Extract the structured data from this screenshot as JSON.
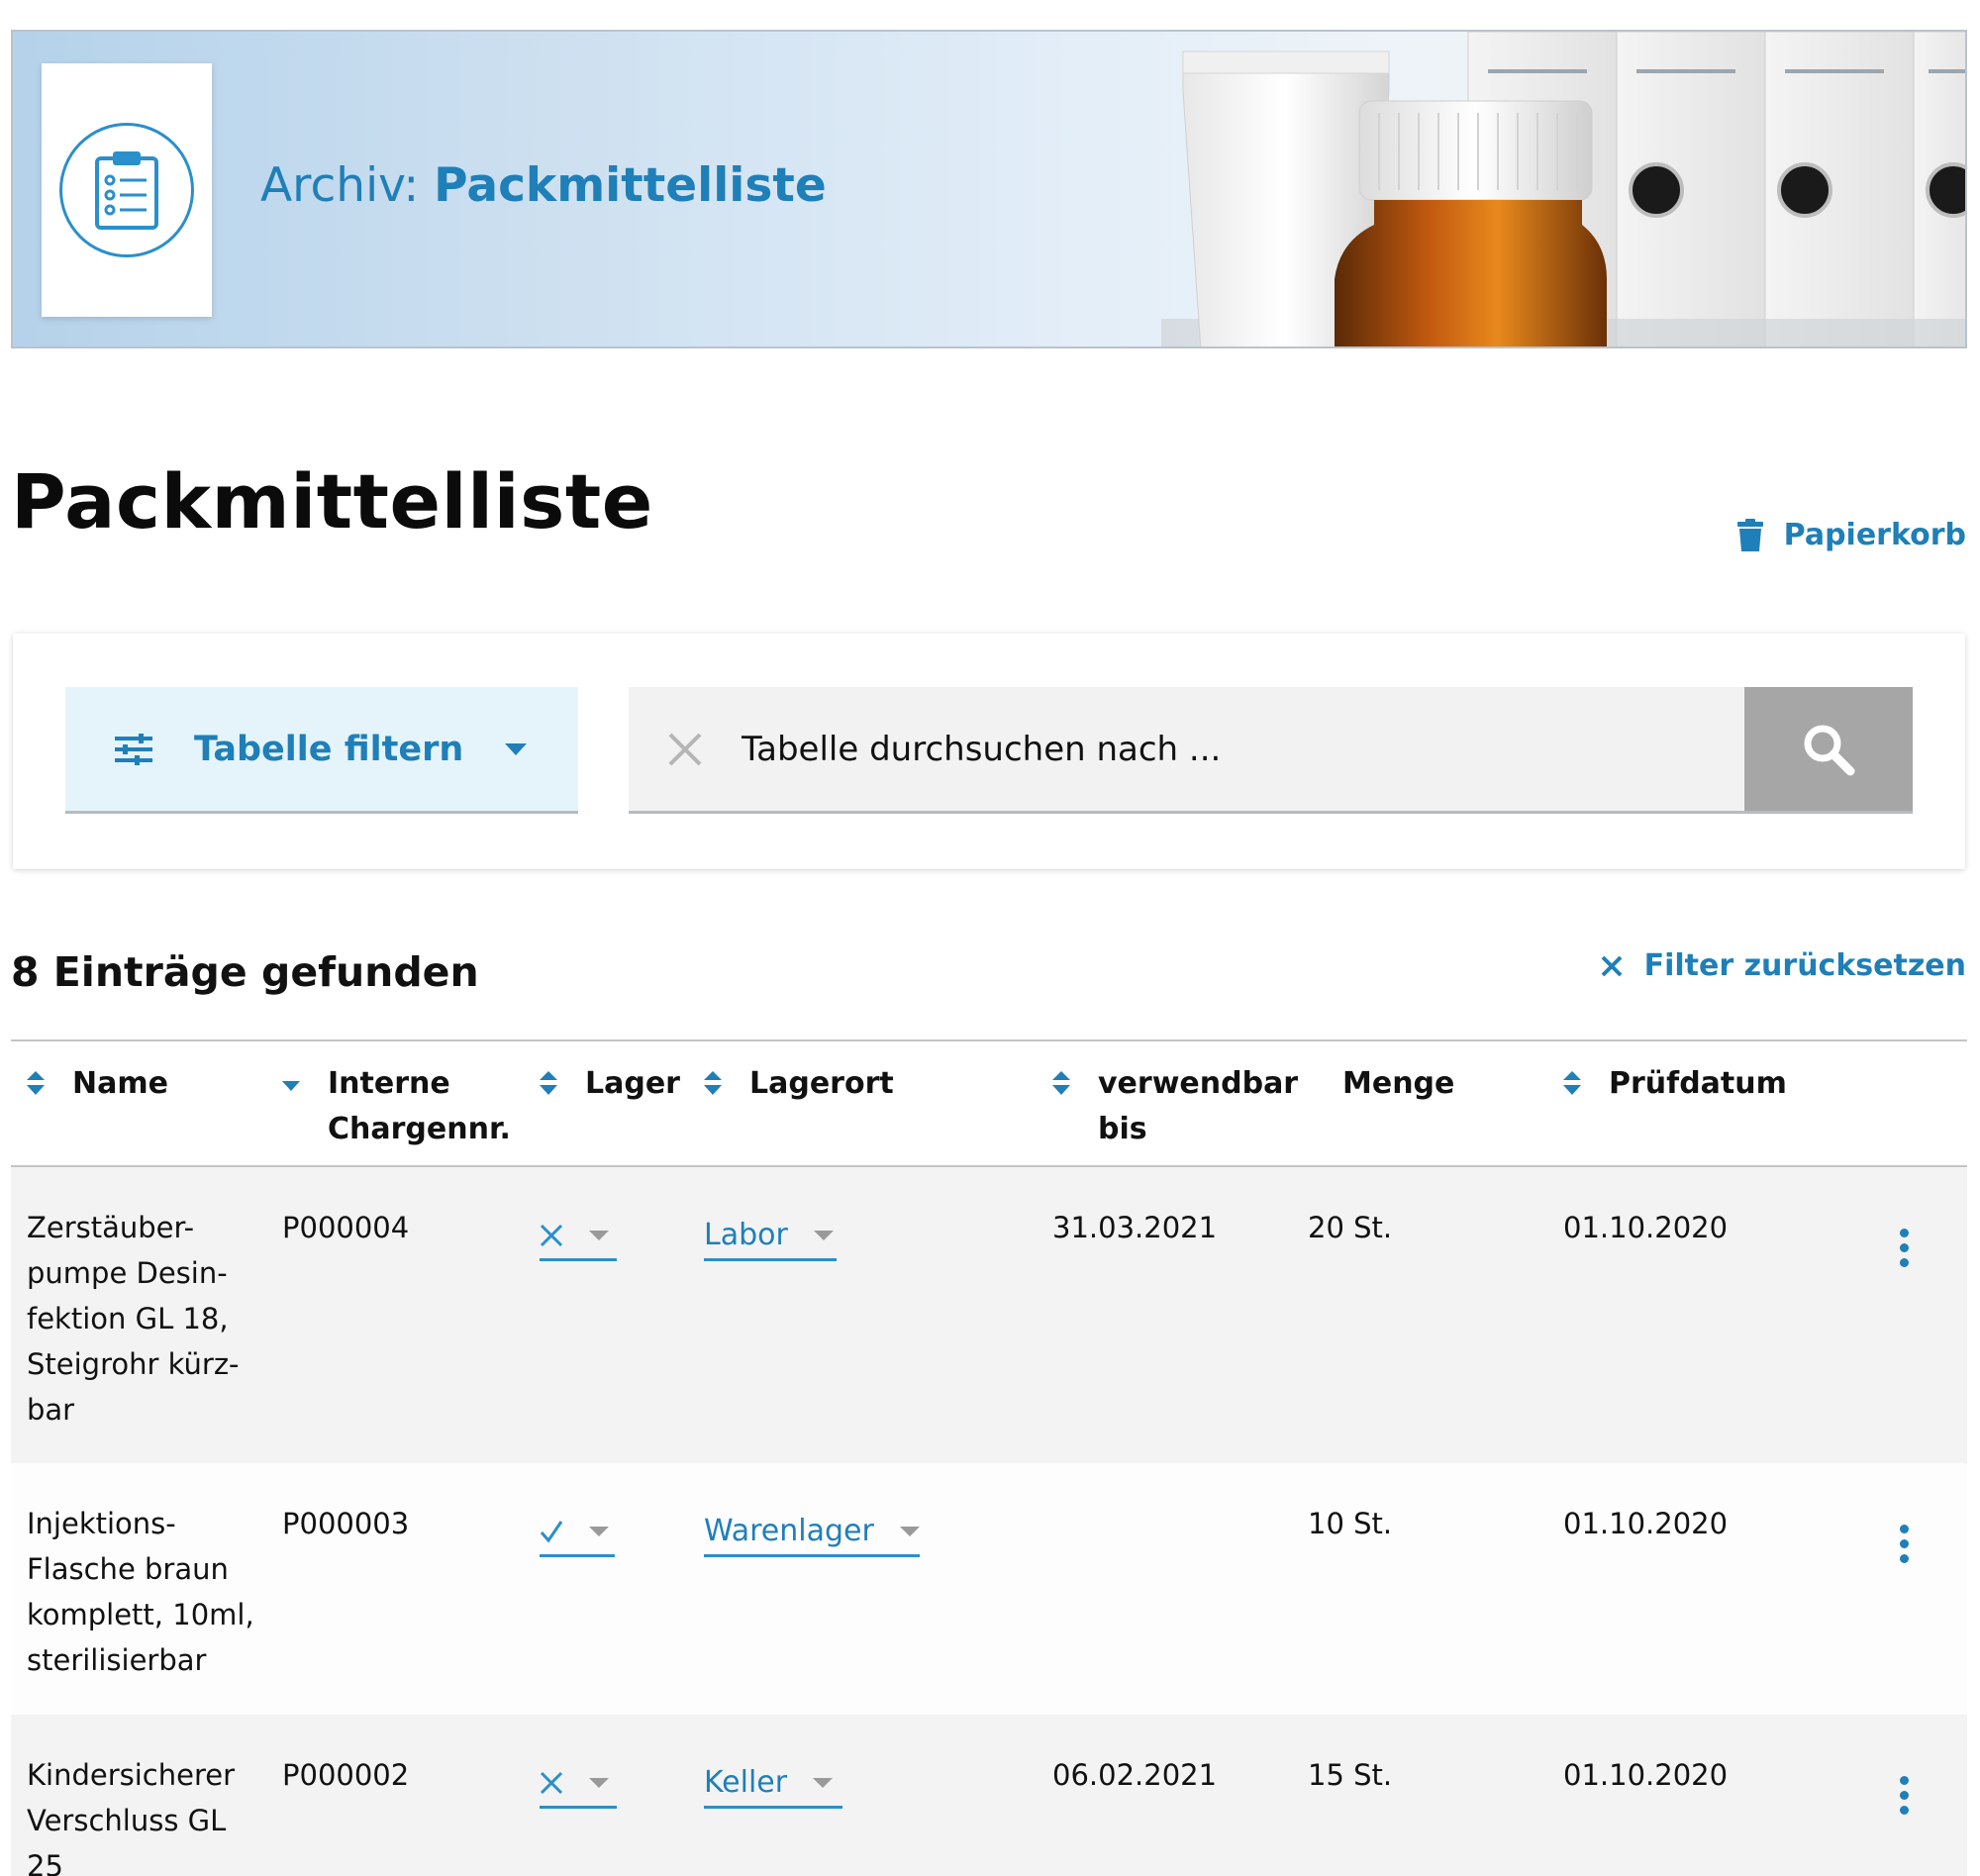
{
  "banner": {
    "title_prefix": "Archiv:",
    "title_main": "Packmittelliste",
    "logo_icon": "clipboard-list-icon"
  },
  "page": {
    "title": "Packmittelliste",
    "trash_label": "Papierkorb"
  },
  "filter": {
    "button_label": "Tabelle filtern",
    "search_placeholder": "Tabelle durchsuchen nach ..."
  },
  "results": {
    "count_label": "8 Einträge gefunden",
    "reset_label": "Filter zurücksetzen"
  },
  "table": {
    "headers": {
      "name": "Name",
      "batch_line1": "Interne",
      "batch_line2": "Chargennr.",
      "storage": "Lager",
      "location": "Lagerort",
      "usable_line1": "verwendbar",
      "usable_line2": "bis",
      "quantity": "Menge",
      "test_date": "Prüfdatum"
    },
    "rows": [
      {
        "name_lines": [
          "Zerstäuber-",
          "pumpe Desin-",
          "fektion GL 18,",
          "Steigrohr kürz-",
          "bar"
        ],
        "batch": "P000004",
        "storage": "cross",
        "location": "Labor",
        "usable_until": "31.03.2021",
        "quantity": "20 St.",
        "test_date": "01.10.2020"
      },
      {
        "name_lines": [
          "Injektions-",
          "Flasche braun",
          "komplett, 10ml,",
          "sterilisierbar"
        ],
        "batch": "P000003",
        "storage": "check",
        "location": "Warenlager",
        "usable_until": "",
        "quantity": "10 St.",
        "test_date": "01.10.2020"
      },
      {
        "name_lines": [
          "Kindersicherer",
          "Verschluss GL",
          "25"
        ],
        "batch": "P000002",
        "storage": "cross",
        "location": "Keller",
        "usable_until": "06.02.2021",
        "quantity": "15 St.",
        "test_date": "01.10.2020"
      }
    ]
  }
}
